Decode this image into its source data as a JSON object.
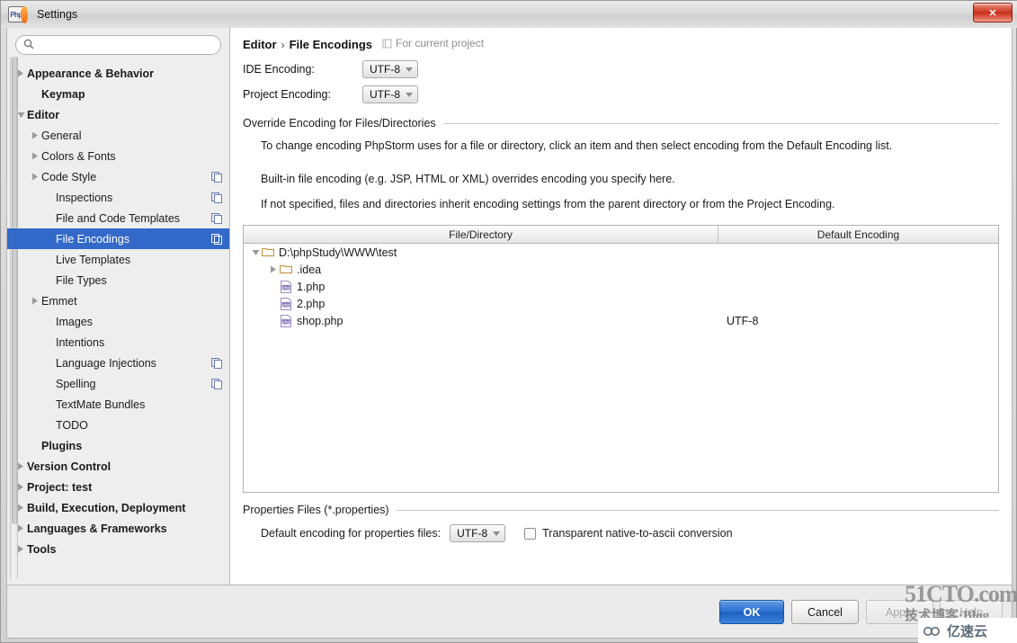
{
  "window": {
    "title": "Settings",
    "app_icon": "phpstorm-icon",
    "close_label": "✕"
  },
  "sidebar": {
    "search": {
      "value": "",
      "placeholder": "",
      "icon": "search-icon"
    },
    "items": [
      {
        "label": "Appearance & Behavior",
        "bold": true,
        "indent": 0,
        "arrow": "right",
        "badge": false
      },
      {
        "label": "Keymap",
        "bold": true,
        "indent": 1,
        "arrow": "none",
        "badge": false
      },
      {
        "label": "Editor",
        "bold": true,
        "indent": 0,
        "arrow": "down",
        "badge": false
      },
      {
        "label": "General",
        "bold": false,
        "indent": 1,
        "arrow": "right",
        "badge": false
      },
      {
        "label": "Colors & Fonts",
        "bold": false,
        "indent": 1,
        "arrow": "right",
        "badge": false
      },
      {
        "label": "Code Style",
        "bold": false,
        "indent": 1,
        "arrow": "right",
        "badge": true
      },
      {
        "label": "Inspections",
        "bold": false,
        "indent": 2,
        "arrow": "none",
        "badge": true
      },
      {
        "label": "File and Code Templates",
        "bold": false,
        "indent": 2,
        "arrow": "none",
        "badge": true
      },
      {
        "label": "File Encodings",
        "bold": false,
        "indent": 2,
        "arrow": "none",
        "badge": true,
        "selected": true
      },
      {
        "label": "Live Templates",
        "bold": false,
        "indent": 2,
        "arrow": "none",
        "badge": false
      },
      {
        "label": "File Types",
        "bold": false,
        "indent": 2,
        "arrow": "none",
        "badge": false
      },
      {
        "label": "Emmet",
        "bold": false,
        "indent": 1,
        "arrow": "right",
        "badge": false
      },
      {
        "label": "Images",
        "bold": false,
        "indent": 2,
        "arrow": "none",
        "badge": false
      },
      {
        "label": "Intentions",
        "bold": false,
        "indent": 2,
        "arrow": "none",
        "badge": false
      },
      {
        "label": "Language Injections",
        "bold": false,
        "indent": 2,
        "arrow": "none",
        "badge": true
      },
      {
        "label": "Spelling",
        "bold": false,
        "indent": 2,
        "arrow": "none",
        "badge": true
      },
      {
        "label": "TextMate Bundles",
        "bold": false,
        "indent": 2,
        "arrow": "none",
        "badge": false
      },
      {
        "label": "TODO",
        "bold": false,
        "indent": 2,
        "arrow": "none",
        "badge": false
      },
      {
        "label": "Plugins",
        "bold": true,
        "indent": 1,
        "arrow": "none",
        "badge": false
      },
      {
        "label": "Version Control",
        "bold": true,
        "indent": 0,
        "arrow": "right",
        "badge": false
      },
      {
        "label": "Project: test",
        "bold": true,
        "indent": 0,
        "arrow": "right",
        "badge": false
      },
      {
        "label": "Build, Execution, Deployment",
        "bold": true,
        "indent": 0,
        "arrow": "right",
        "badge": false
      },
      {
        "label": "Languages & Frameworks",
        "bold": true,
        "indent": 0,
        "arrow": "right",
        "badge": false
      },
      {
        "label": "Tools",
        "bold": true,
        "indent": 0,
        "arrow": "right",
        "badge": false
      }
    ]
  },
  "main": {
    "breadcrumb": {
      "parent": "Editor",
      "separator": "›",
      "current": "File Encodings"
    },
    "scope": {
      "icon": "project-scope-icon",
      "label": "For current project"
    },
    "ide_encoding": {
      "label": "IDE Encoding:",
      "value": "UTF-8"
    },
    "project_encoding": {
      "label": "Project Encoding:",
      "value": "UTF-8"
    },
    "override_group": {
      "title": "Override Encoding for Files/Directories"
    },
    "paragraphs": [
      "To change encoding PhpStorm uses for a file or directory, click an item and then select encoding from the Default Encoding list.",
      "Built-in file encoding (e.g. JSP, HTML or XML) overrides encoding you specify here.",
      "If not specified, files and directories inherit encoding settings from the parent directory or from the Project Encoding."
    ],
    "table": {
      "columns": [
        "File/Directory",
        "Default Encoding"
      ],
      "rows": [
        {
          "name": "D:\\phpStudy\\WWW\\test",
          "encoding": "",
          "icon": "folder-icon",
          "arrow": "down",
          "indent": 0
        },
        {
          "name": ".idea",
          "encoding": "",
          "icon": "folder-icon",
          "arrow": "right",
          "indent": 1
        },
        {
          "name": "1.php",
          "encoding": "",
          "icon": "php-file-icon",
          "arrow": "none",
          "indent": 1
        },
        {
          "name": "2.php",
          "encoding": "",
          "icon": "php-file-icon",
          "arrow": "none",
          "indent": 1
        },
        {
          "name": "shop.php",
          "encoding": "UTF-8",
          "icon": "php-file-icon",
          "arrow": "none",
          "indent": 1
        }
      ]
    },
    "properties_group": {
      "title": "Properties Files (*.properties)"
    },
    "properties_encoding": {
      "label": "Default encoding for properties files:",
      "value": "UTF-8"
    },
    "transparent_checkbox": {
      "label": "Transparent native-to-ascii conversion",
      "checked": false
    }
  },
  "footer": {
    "ok": "OK",
    "cancel": "Cancel",
    "apply": "Apply",
    "help": "Help"
  },
  "watermarks": {
    "site": "51CTO.com",
    "site_sub": "技术博客·Blog",
    "cloud": "亿速云"
  }
}
